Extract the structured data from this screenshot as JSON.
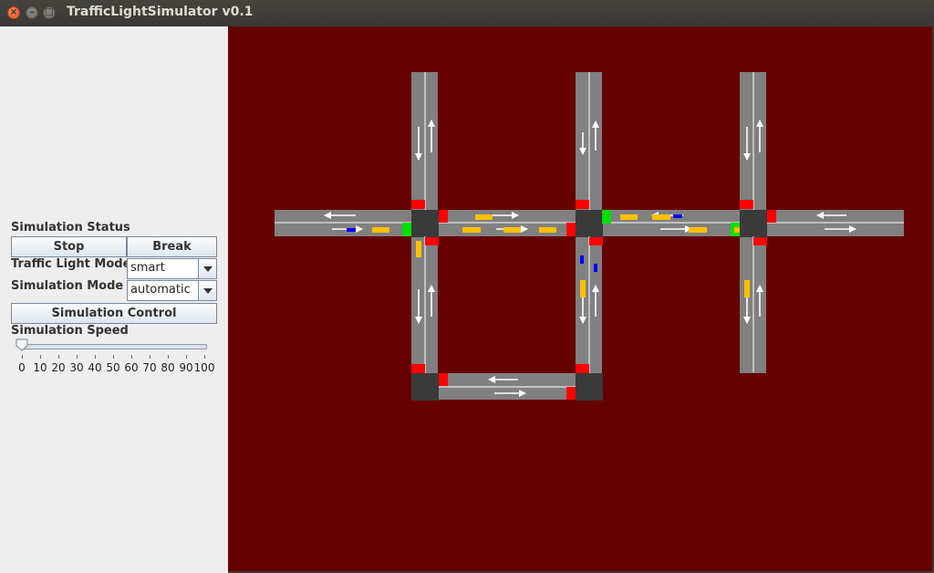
{
  "window": {
    "title": "TrafficLightSimulator v0.1",
    "close_glyph": "×",
    "minimize_glyph": "–",
    "maximize_glyph": "□"
  },
  "controls": {
    "status_label": "Simulation Status",
    "stop_label": "Stop",
    "break_label": "Break",
    "traffic_light_mode_label": "Traffic Light Mode",
    "traffic_light_mode_value": "smart",
    "simulation_mode_label": "Simulation Mode",
    "simulation_mode_value": "automatic",
    "simulation_control_label": "Simulation Control",
    "speed_label": "Simulation Speed",
    "speed_value": 0,
    "speed_ticks": [
      "0",
      "10",
      "20",
      "30",
      "40",
      "50",
      "60",
      "70",
      "80",
      "90",
      "100"
    ]
  },
  "colors": {
    "map_background": "#650000",
    "road": "#808080",
    "intersection": "#3a3a3a",
    "light_red": "#ff0000",
    "light_green": "#00e000",
    "car_yellow": "#ffc000",
    "car_blue": "#0000ff"
  }
}
